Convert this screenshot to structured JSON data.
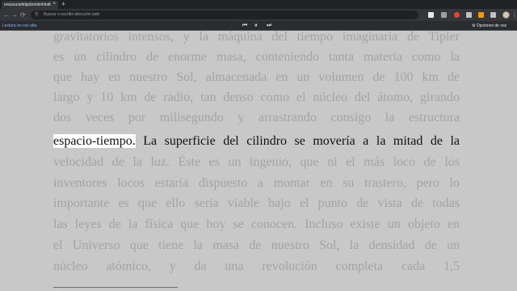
{
  "tab": {
    "title": "eniusucadelguborisiohindrogen...",
    "close": "×"
  },
  "new_tab": "+",
  "toolbar": {
    "back": "←",
    "forward": "→",
    "reload": "⟳",
    "search_icon": "⚲",
    "omnibox_placeholder": "Buscar o escribir dirección web",
    "menu": "⋮"
  },
  "reader": {
    "read_aloud": "Lectura en voz alta",
    "prev": "⏮",
    "pause": "⏸",
    "next": "⏭",
    "voice_options_icon": "⚙",
    "voice_options": "Opciones de voz"
  },
  "colors": {
    "highlight": "#ffffff",
    "active_text": "#111111",
    "dim_text": "#a3a3a3",
    "page_bg": "#c8c8c8"
  },
  "text": {
    "lines": [
      "gravitatorios intensos, y la máquina del tiempo imaginaria de Tipler",
      "es un cilindro de enorme masa, conteniendo tanta materia como la",
      "que hay en nuestro Sol, almacenada en un volumen de 100 km de",
      "largo y 10 km de radio, tan denso como el núcleo del átomo, girando",
      "dos veces por milisegundo y arrastrando consigo la estructura",
      "velocidad de la luz. Éste es un ingenio, que ni el más loco de los",
      "inventores locos estaría dispuesto a montar en su trastero, pero lo",
      "importante es que ello sería viable bajo el punto de vista de todas",
      "las leyes de la física que hoy se conocen. Incluso existe un objeto en",
      "el Universo que tiene la masa de nuestro Sol, la densidad de un",
      "núcleo atómico, y da una revolución completa cada 1,5"
    ],
    "highlighted_word": "espacio-tiempo.",
    "active_sentence": " La superficie del cilindro se movería a la mitad de la"
  }
}
